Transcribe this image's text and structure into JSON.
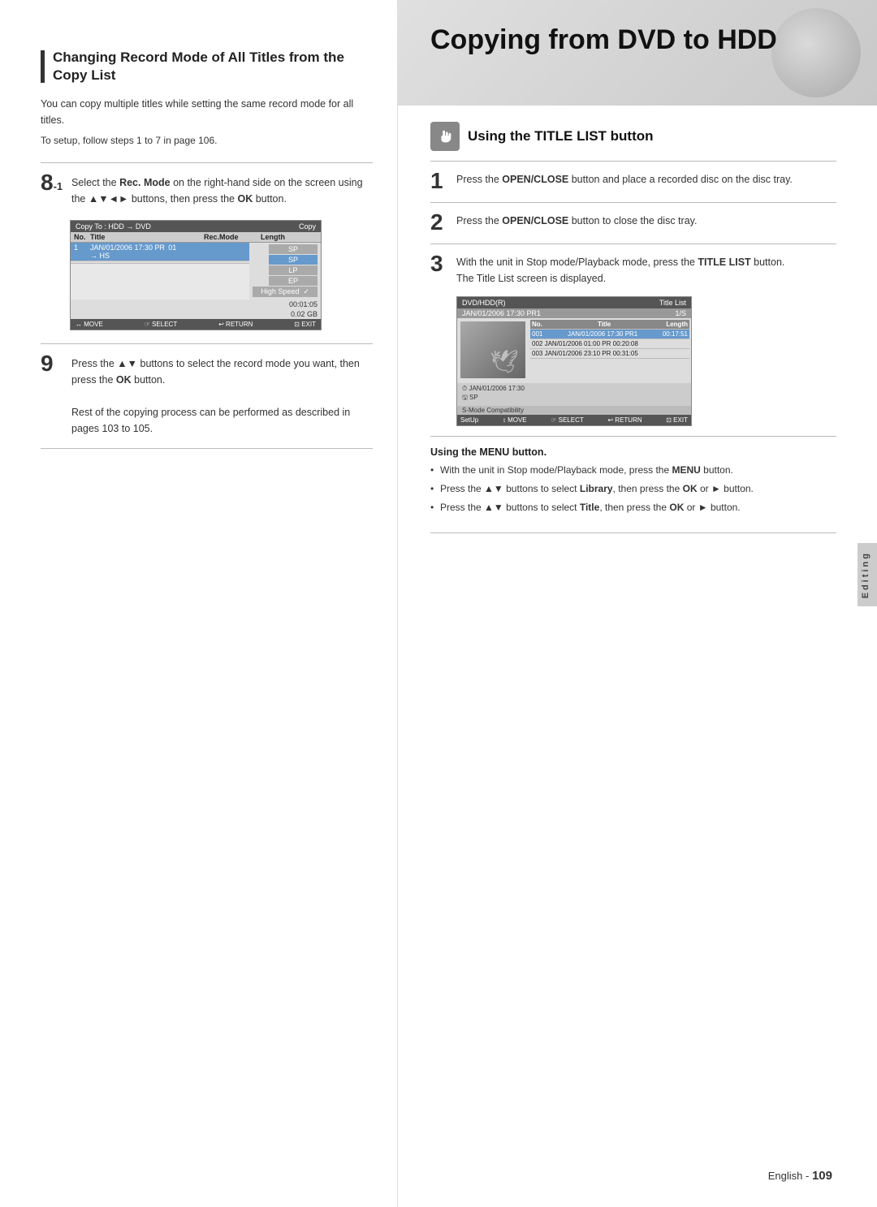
{
  "left": {
    "section_title": "Changing Record Mode of All Titles from the Copy List",
    "body_text": "You can copy multiple titles while setting the same record mode for all titles.",
    "setup_text": "To setup, follow steps 1 to 7 in page 106.",
    "step8": {
      "number": "8",
      "sub": "-1",
      "content": "Select the Rec. Mode on the right-hand side on the screen using the ▲▼◄► buttons, then press the OK button."
    },
    "step9": {
      "number": "9",
      "content": "Press the ▲▼ buttons to select the record mode you want, then press the OK button.",
      "extra": "Rest of the copying process can be performed as described in pages 103 to 105."
    },
    "screenshot": {
      "header_left": "Copy",
      "header_right": "Copy",
      "subheader": "Copy To : HDD → DVD",
      "columns": [
        "No.",
        "Title",
        "Rec.Mode",
        "Length"
      ],
      "row": [
        "1",
        "JAN/01/2006 17:30 PR → HS",
        "01",
        ""
      ],
      "options": [
        "SP",
        "SP",
        "LP",
        "EP",
        "High Speed"
      ],
      "selected_option": "SP",
      "checkmark_option": "High Speed",
      "time": "00:01:05",
      "size": "0.02 GB",
      "footer": [
        "↔ MOVE",
        "☞ SELECT",
        "↩ RETURN",
        "⊡ EXIT"
      ]
    }
  },
  "right": {
    "header_title": "Copying from DVD to HDD",
    "icon_label": "Using the TITLE LIST button",
    "step1": {
      "number": "1",
      "content": "Press the OPEN/CLOSE button and place a recorded disc on the disc tray."
    },
    "step2": {
      "number": "2",
      "content": "Press the OPEN/CLOSE button to close the disc tray."
    },
    "step3": {
      "number": "3",
      "content": "With the unit in Stop mode/Playback mode, press the TITLE LIST button.",
      "sub_content": "The Title List screen is displayed."
    },
    "screenshot_right": {
      "header_left": "DVD/HDD(R)",
      "header_right": "Title List",
      "subheader_left": "JAN/01/2006 17:30 PR1",
      "subheader_right": "1/S",
      "list_columns": [
        "No.",
        "Title",
        "Length"
      ],
      "list_rows": [
        {
          "no": "001",
          "title": "JAN/01/2006 17:30 PR1",
          "length": "00:17:51",
          "selected": true
        },
        {
          "no": "002",
          "title": "JAN/01/2006 01:00 PR 00:20:08",
          "selected": false
        },
        {
          "no": "003",
          "title": "JAN/01/2006 23:10 PR 00:31:05",
          "selected": false
        }
      ],
      "info_date": "JAN/01/2006 17:30",
      "info_mode": "SP",
      "compat": "S-Mode Compatibility",
      "footer": [
        "SetUp",
        "↕ MOVE",
        "☞ SELECT",
        "↩ RETURN",
        "⊡ EXIT"
      ]
    },
    "menu_section": {
      "title": "Using the MENU button.",
      "bullets": [
        "With the unit in Stop mode/Playback mode, press the MENU button.",
        "Press the ▲▼ buttons to select Library, then press the OK or ► button.",
        "Press the ▲▼ buttons to select Title, then press the OK or ► button."
      ]
    },
    "page_number": "109",
    "page_label": "English -",
    "editing_tab": "Editing"
  }
}
